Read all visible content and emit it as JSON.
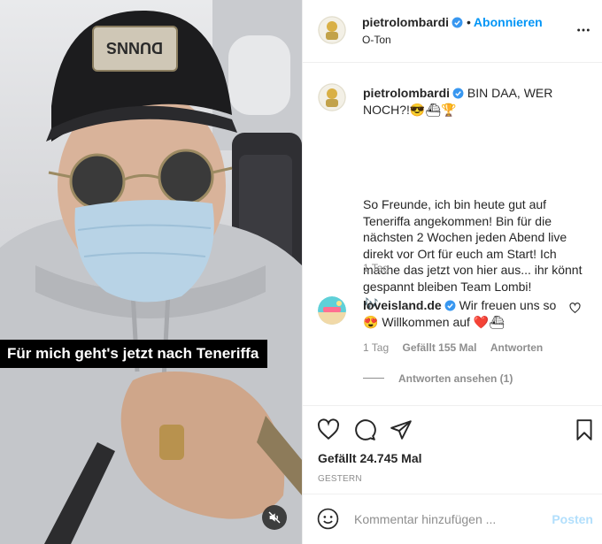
{
  "media": {
    "cap_text": "DUNNS",
    "caption": "Für mich geht's jetzt nach Teneriffa",
    "mute_icon": "speaker-muted-icon"
  },
  "header": {
    "username": "pietrolombardi",
    "follow_label": "Abonnieren",
    "separator": "•",
    "subtitle": "O-Ton"
  },
  "post": {
    "username": "pietrolombardi",
    "title_text": "BIN DAA, WER NOCH?!",
    "title_emojis": "😎⛴🏆",
    "body": "So Freunde, ich bin heute gut auf Teneriffa angekommen! Bin für die nächsten 2 Wochen jeden Abend live direkt vor Ort für euch am Start! Ich mache das jetzt von hier aus... ihr könnt gespannt bleiben Team Lombi!",
    "body_emoji": "🎶",
    "age": "1 Tag"
  },
  "comment": {
    "username": "loveisland.de",
    "text_line1": "Wir freuen uns",
    "text_line2_prefix": "so",
    "emoji1": "😍",
    "text_line2_mid": "Willkommen auf",
    "emoji2": "❤️",
    "emoji3": "⛴",
    "age": "1 Tag",
    "likes": "Gefällt 155 Mal",
    "reply": "Antworten",
    "view_replies": "Antworten ansehen (1)"
  },
  "actions": {
    "likes": "Gefällt 24.745 Mal",
    "date": "GESTERN",
    "icons": [
      "heart-icon",
      "comment-icon",
      "share-icon",
      "bookmark-icon"
    ]
  },
  "comment_bar": {
    "placeholder": "Kommentar hinzufügen ...",
    "post_label": "Posten",
    "emoji_icon": "smiley-icon"
  },
  "colors": {
    "link_blue": "#0095f6",
    "verified_blue": "#3897f0",
    "muted_text": "#8e8e8e",
    "disabled_blue": "#b2dffc"
  }
}
